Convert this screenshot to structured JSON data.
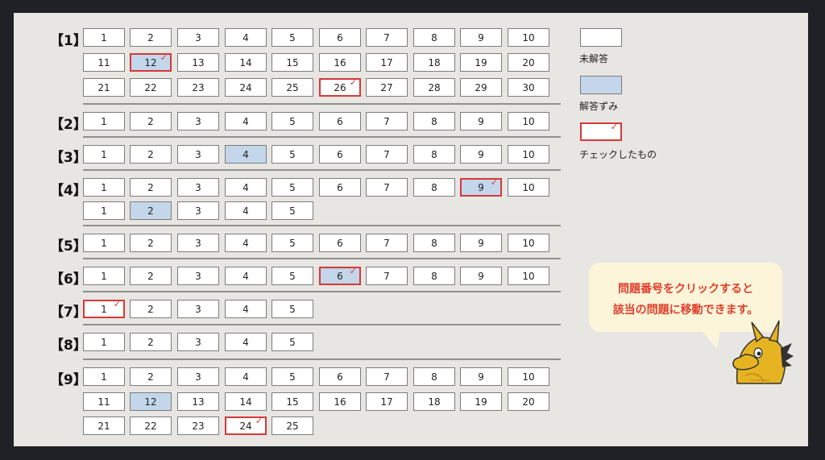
{
  "sections": [
    {
      "label": "【1】",
      "answered": [
        12
      ],
      "checked": [
        12,
        26
      ],
      "rows": [
        [
          1,
          2,
          3,
          4,
          5,
          6,
          7,
          8,
          9,
          10
        ],
        [
          11,
          12,
          13,
          14,
          15,
          16,
          17,
          18,
          19,
          20
        ],
        [
          21,
          22,
          23,
          24,
          25,
          26,
          27,
          28,
          29,
          30
        ]
      ]
    },
    {
      "label": "【2】",
      "answered": [],
      "checked": [],
      "rows": [
        [
          1,
          2,
          3,
          4,
          5,
          6,
          7,
          8,
          9,
          10
        ]
      ]
    },
    {
      "label": "【3】",
      "answered": [
        4
      ],
      "checked": [],
      "rows": [
        [
          1,
          2,
          3,
          4,
          5,
          6,
          7,
          8,
          9,
          10
        ]
      ]
    },
    {
      "label": "【4】",
      "answered": [
        9,
        2
      ],
      "checked": [
        9
      ],
      "rows": [
        [
          1,
          2,
          3,
          4,
          5,
          6,
          7,
          8,
          9,
          10
        ],
        [
          1,
          2,
          3,
          4,
          5
        ]
      ],
      "row_answered": [
        [
          9
        ],
        [
          2
        ]
      ]
    },
    {
      "label": "【5】",
      "answered": [],
      "checked": [],
      "rows": [
        [
          1,
          2,
          3,
          4,
          5,
          6,
          7,
          8,
          9,
          10
        ]
      ]
    },
    {
      "label": "【6】",
      "answered": [
        6
      ],
      "checked": [
        6
      ],
      "rows": [
        [
          1,
          2,
          3,
          4,
          5,
          6,
          7,
          8,
          9,
          10
        ]
      ]
    },
    {
      "label": "【7】",
      "answered": [],
      "checked": [
        1
      ],
      "rows": [
        [
          1,
          2,
          3,
          4,
          5
        ]
      ]
    },
    {
      "label": "【8】",
      "answered": [],
      "checked": [],
      "rows": [
        [
          1,
          2,
          3,
          4,
          5
        ]
      ]
    },
    {
      "label": "【9】",
      "answered": [
        12
      ],
      "checked": [
        24
      ],
      "rows": [
        [
          1,
          2,
          3,
          4,
          5,
          6,
          7,
          8,
          9,
          10
        ],
        [
          11,
          12,
          13,
          14,
          15,
          16,
          17,
          18,
          19,
          20
        ],
        [
          21,
          22,
          23,
          24,
          25
        ]
      ]
    }
  ],
  "legend": {
    "unanswered": "未解答",
    "answered": "解答ずみ",
    "checked": "チェックしたもの"
  },
  "bubble": {
    "line1": "問題番号をクリックすると",
    "line2": "該当の問題に移動できます。"
  },
  "check_mark": "✓",
  "colors": {
    "answered": "#c4d6ea",
    "checked_border": "#d33a3a",
    "bubble_text": "#e0402d",
    "bubble_bg": "#fdf5d9"
  }
}
